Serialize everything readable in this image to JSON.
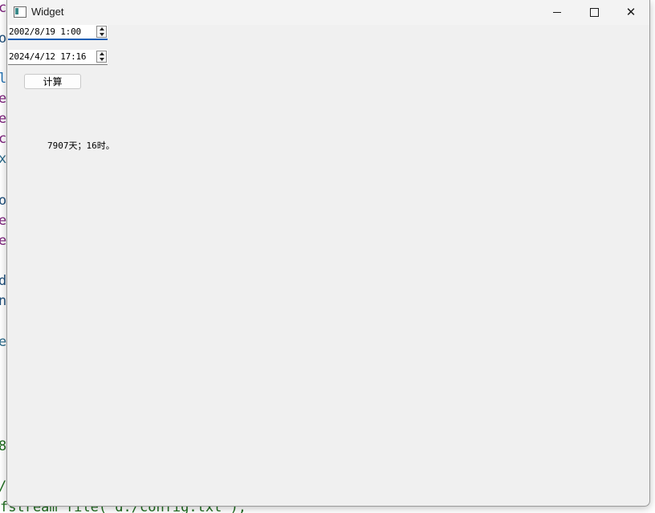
{
  "background": {
    "bottom_code_text": "fstream file(\"d:/config.txt\");"
  },
  "window": {
    "title": "Widget",
    "controls": {
      "minimize_icon": "minimize-icon",
      "maximize_icon": "maximize-icon",
      "close_icon": "close-icon",
      "close_glyph": "✕"
    }
  },
  "start_datetime": {
    "value": "2002/8/19 1:00"
  },
  "end_datetime": {
    "value": "2024/4/12 17:16"
  },
  "calculate_button": {
    "label": "计算"
  },
  "result": {
    "text": "7907天；16时。"
  }
}
